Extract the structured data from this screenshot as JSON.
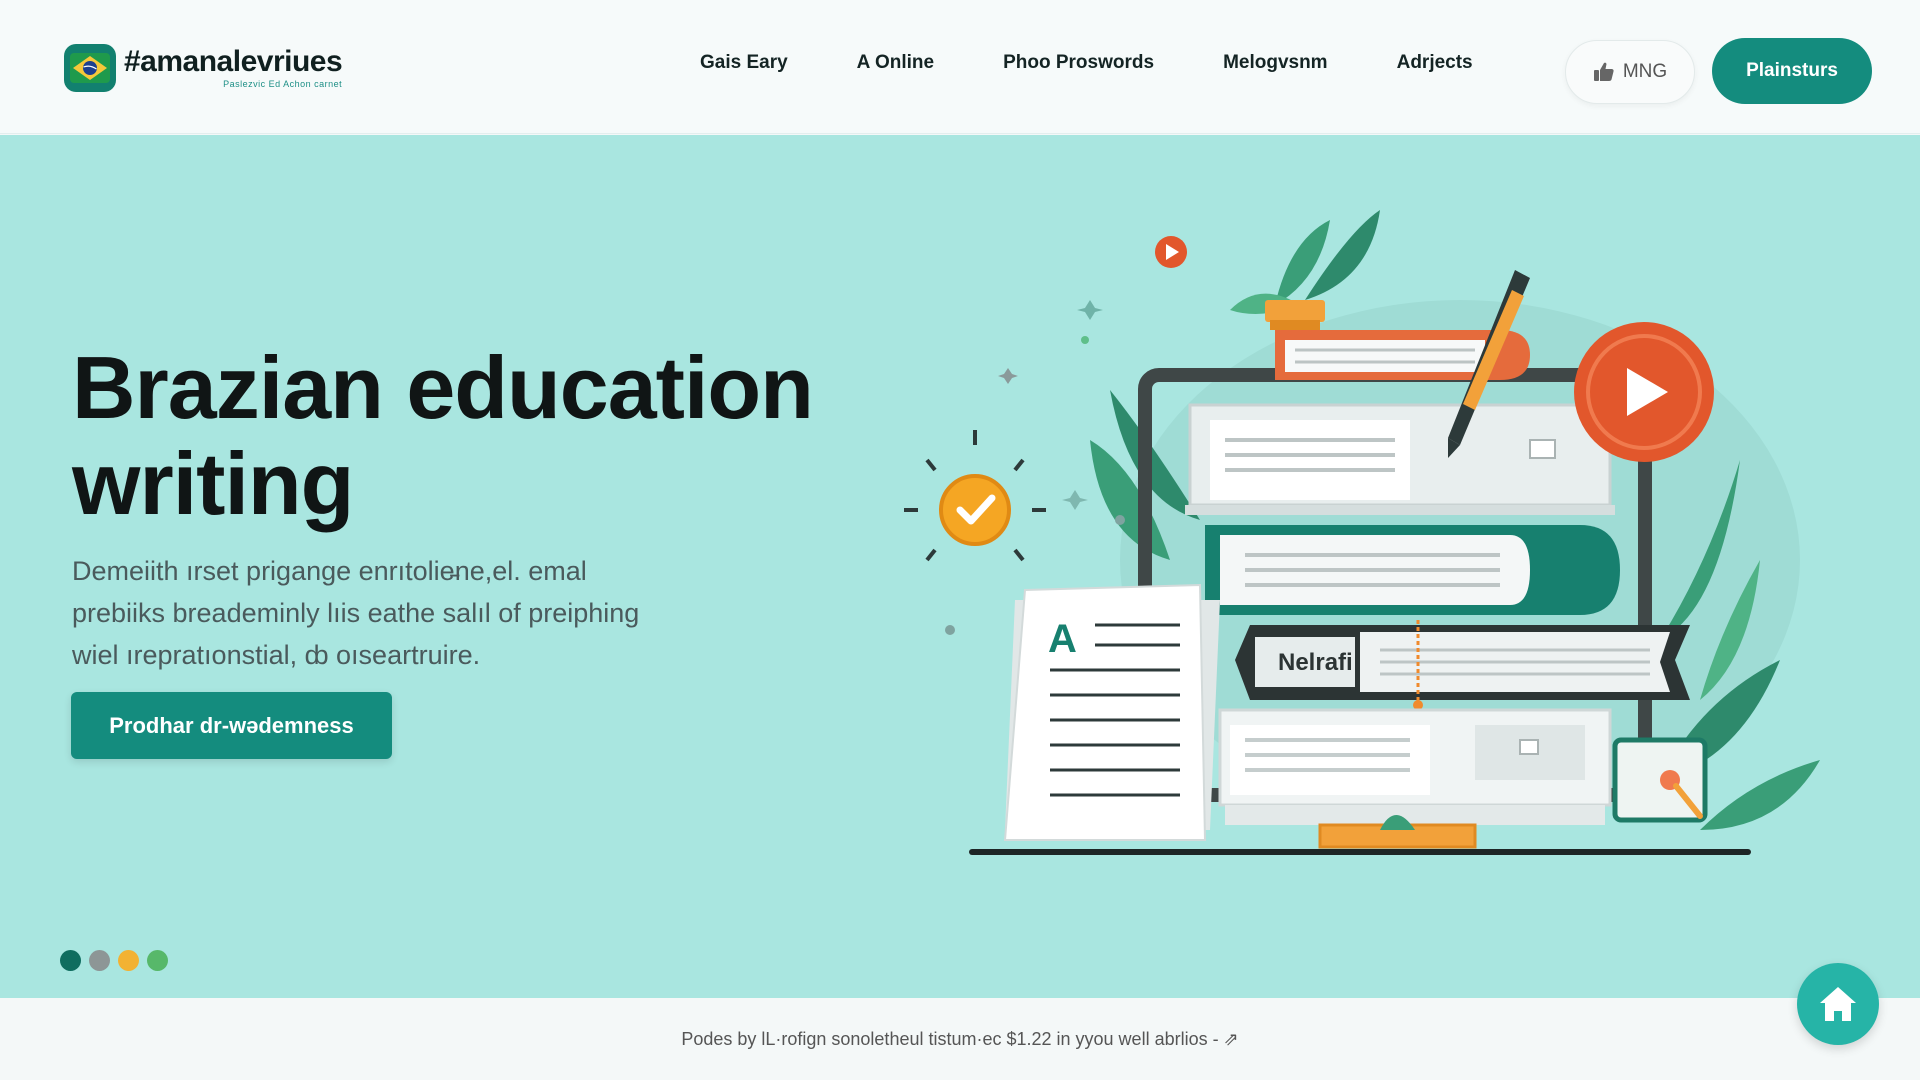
{
  "brand": {
    "title": "#amanalevriues",
    "subtitle": "Paslezvic Ed Achon carnet"
  },
  "nav": {
    "items": [
      "Gais Eary",
      "A Online",
      "Phoo Proswords",
      "Melogvsnm",
      "Adrjects"
    ]
  },
  "header": {
    "lang_label": "MNG",
    "cta_label": "Plainsturs"
  },
  "hero": {
    "title_line1": "Brazian education",
    "title_line2": "writing",
    "desc_line1": "Demeiith ırset prigange enrıtolie̵ne,el. emal",
    "desc_line2": "prebiiks breademinly lıis eathe salıl of preiphing",
    "desc_line3": "wiel ırepratıonstial, ȸ oıseartruire.",
    "button_label": "Prodhar dr-wǝdemness"
  },
  "illustration": {
    "book_label": "Nelrafi",
    "doc_letter": "A"
  },
  "carousel": {
    "dot_colors": [
      "#0f6d5f",
      "#8d9696",
      "#f2b233",
      "#57b86a"
    ]
  },
  "footer": {
    "text": "Podes by lL·rofign sonoletheul tistum·ec $1.22 in уyou well abrlios - ⇗"
  },
  "colors": {
    "accent": "#148c7e",
    "hero_bg": "#a9e6e0",
    "play_orange": "#e2572c",
    "check_yellow": "#f5a623"
  }
}
